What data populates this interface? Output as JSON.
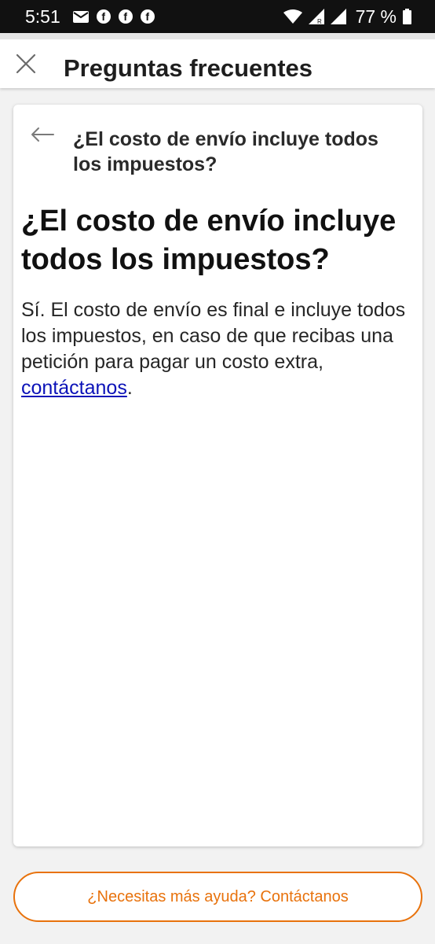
{
  "status_bar": {
    "time": "5:51",
    "battery_text": "77 %",
    "notification_icons": [
      "mail-icon",
      "facebook-icon",
      "facebook-icon",
      "facebook-icon"
    ],
    "fb_glyph": "f"
  },
  "header": {
    "title": "Preguntas frecuentes",
    "close_icon": "close-icon"
  },
  "card": {
    "subtitle": "¿El costo de envío incluye todos los impuestos?",
    "back_icon": "back-arrow-icon",
    "article_title": "¿El costo de envío incluye todos los impuestos?",
    "body_text": "Sí. El costo de envío es final e incluye todos los impuestos, en caso de que recibas una petición para pagar un costo extra, ",
    "body_link": "contáctanos",
    "body_end": "."
  },
  "help_button": {
    "label": "¿Necesitas más ayuda? Contáctanos"
  },
  "colors": {
    "accent": "#e8720c",
    "link": "#0b12b8",
    "status_bar": "#111111"
  }
}
